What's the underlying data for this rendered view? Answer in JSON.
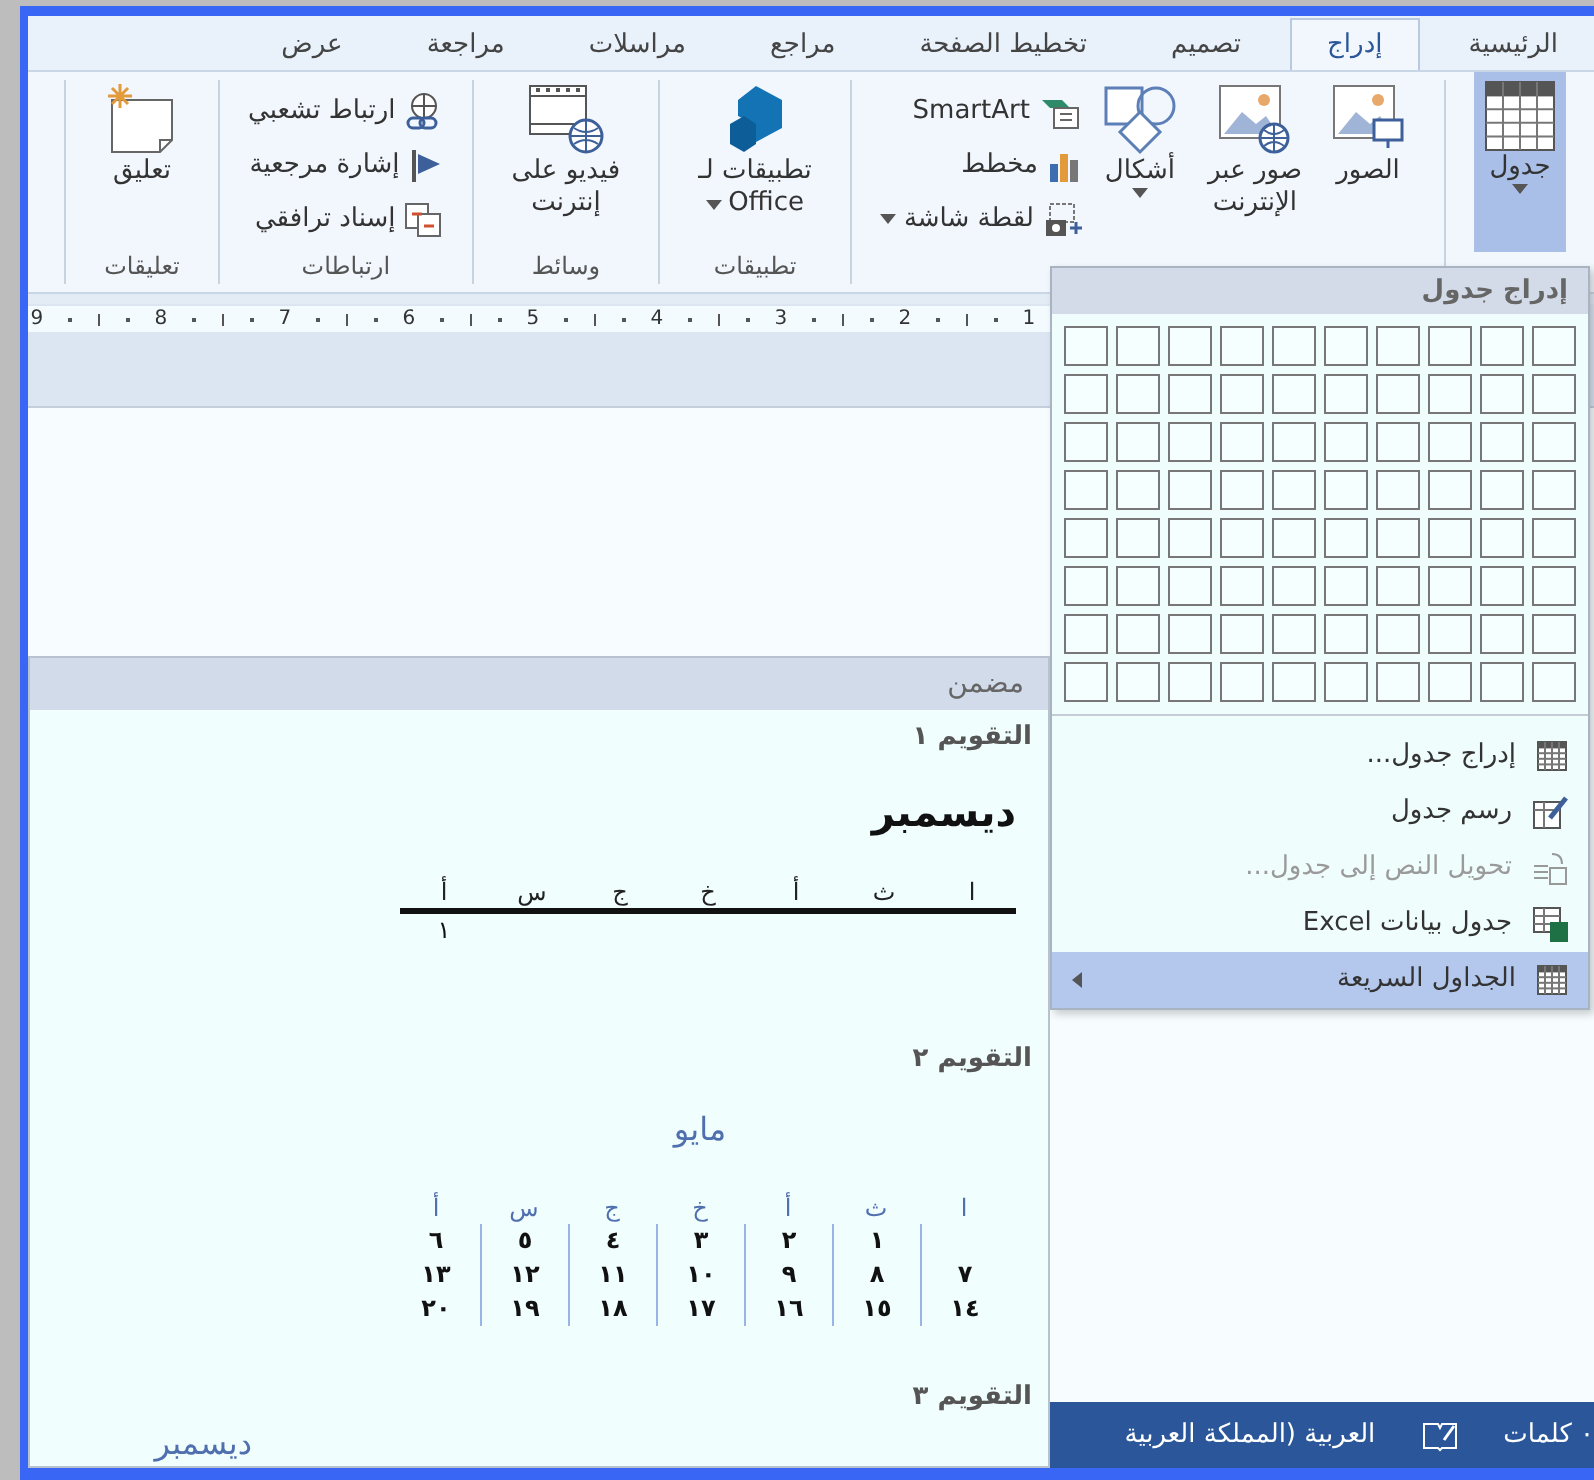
{
  "tabs": [
    {
      "label": "الرئيسية",
      "selected": false
    },
    {
      "label": "إدراج",
      "selected": true
    },
    {
      "label": "تصميم",
      "selected": false
    },
    {
      "label": "تخطيط الصفحة",
      "selected": false
    },
    {
      "label": "مراجع",
      "selected": false
    },
    {
      "label": "مراسلات",
      "selected": false
    },
    {
      "label": "مراجعة",
      "selected": false
    },
    {
      "label": "عرض",
      "selected": false
    }
  ],
  "ribbon": {
    "groups": [
      {
        "large": [
          {
            "lines": [
              "جدول"
            ],
            "caret": true,
            "highlighted": true
          }
        ]
      },
      {
        "large": [
          {
            "lines": [
              "الصور"
            ],
            "caret": false,
            "highlighted": false
          },
          {
            "lines": [
              "صور عبر",
              "الإنترنت"
            ],
            "caret": false,
            "highlighted": false
          },
          {
            "lines": [
              "أشكال"
            ],
            "caret": true,
            "highlighted": false
          }
        ],
        "small": [
          {
            "label": "SmartArt",
            "caret": false
          },
          {
            "label": "مخطط",
            "caret": false
          },
          {
            "label": "لقطة شاشة",
            "caret": true
          }
        ]
      },
      {
        "label": "تطبيقات",
        "large": [
          {
            "lines": [
              "تطبيقات لـ",
              "Office"
            ],
            "caret": true,
            "highlighted": false
          }
        ]
      },
      {
        "label": "وسائط",
        "large": [
          {
            "lines": [
              "فيديو على",
              "إنترنت"
            ],
            "caret": false,
            "highlighted": false
          }
        ]
      },
      {
        "label": "ارتباطات",
        "small": [
          {
            "label": "ارتباط تشعبي",
            "caret": false
          },
          {
            "label": "إشارة مرجعية",
            "caret": false
          },
          {
            "label": "إسناد ترافقي",
            "caret": false
          }
        ]
      },
      {
        "label": "تعليقات",
        "large": [
          {
            "lines": [
              "تعليق"
            ],
            "caret": false,
            "highlighted": false
          }
        ]
      }
    ]
  },
  "ruler": [
    "1",
    "2",
    "3",
    "4",
    "5",
    "6",
    "7",
    "8",
    "9"
  ],
  "table_menu": {
    "header": "إدراج جدول",
    "items": [
      {
        "label": "إدراج جدول...",
        "disabled": false,
        "highlighted": false,
        "submenu": false
      },
      {
        "label": "رسم جدول",
        "disabled": false,
        "highlighted": false,
        "submenu": false
      },
      {
        "label": "تحويل النص إلى جدول...",
        "disabled": true,
        "highlighted": false,
        "submenu": false
      },
      {
        "label": "جدول بيانات Excel",
        "disabled": false,
        "highlighted": false,
        "submenu": false
      },
      {
        "label": "الجداول السريعة",
        "disabled": false,
        "highlighted": true,
        "submenu": true
      }
    ]
  },
  "gallery": {
    "header": "مضمن",
    "items": [
      {
        "title": "التقويم ١",
        "kind": "plain",
        "month": "ديسمبر",
        "weekdays": [
          "ا",
          "ث",
          "أ",
          "خ",
          "ج",
          "س",
          "أ"
        ],
        "rows": [
          [
            "",
            "",
            "",
            "",
            "",
            "",
            "١"
          ]
        ]
      },
      {
        "title": "التقويم ٢",
        "kind": "ruled",
        "month": "مايو",
        "weekdays": [
          "ا",
          "ث",
          "أ",
          "خ",
          "ج",
          "س",
          "أ"
        ],
        "rows": [
          [
            "",
            "١",
            "٢",
            "٣",
            "٤",
            "٥",
            "٦"
          ],
          [
            "٧",
            "٨",
            "٩",
            "١٠",
            "١١",
            "١٢",
            "١٣"
          ],
          [
            "١٤",
            "١٥",
            "١٦",
            "١٧",
            "١٨",
            "١٩",
            "٢٠"
          ]
        ]
      },
      {
        "title": "التقويم ٣",
        "kind": "banner",
        "month": "ديسمبر"
      }
    ]
  },
  "status_bar": {
    "word_count": "٠ كلمات",
    "language": "العربية (المملكة العربية"
  }
}
